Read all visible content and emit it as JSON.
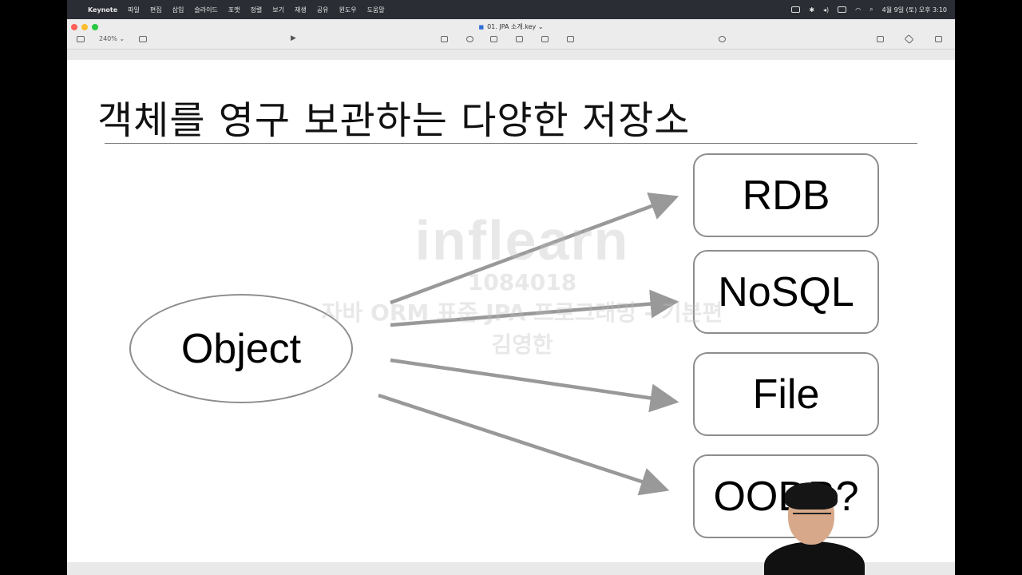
{
  "menubar": {
    "app_name": "Keynote",
    "menus": [
      "파일",
      "편집",
      "삽입",
      "슬라이드",
      "포맷",
      "정렬",
      "보기",
      "재생",
      "공유",
      "윈도우",
      "도움말"
    ],
    "datetime": "4월 9일 (토) 오후 3:10"
  },
  "window": {
    "title": "01. JPA 소개.key",
    "zoom": "240%"
  },
  "slide": {
    "title": "객체를 영구 보관하는 다양한 저장소",
    "object_label": "Object",
    "stores": [
      "RDB",
      "NoSQL",
      "File",
      "OODB?"
    ]
  },
  "watermark": {
    "logo": "inflearn",
    "id": "1084018",
    "course": "자바 ORM 표준 JPA 프로그래밍 - 기본편",
    "author": "김영한"
  },
  "colors": {
    "arrow": "#999999",
    "shape_border": "#8d8d8d",
    "menubar_bg": "#2a2d33"
  }
}
